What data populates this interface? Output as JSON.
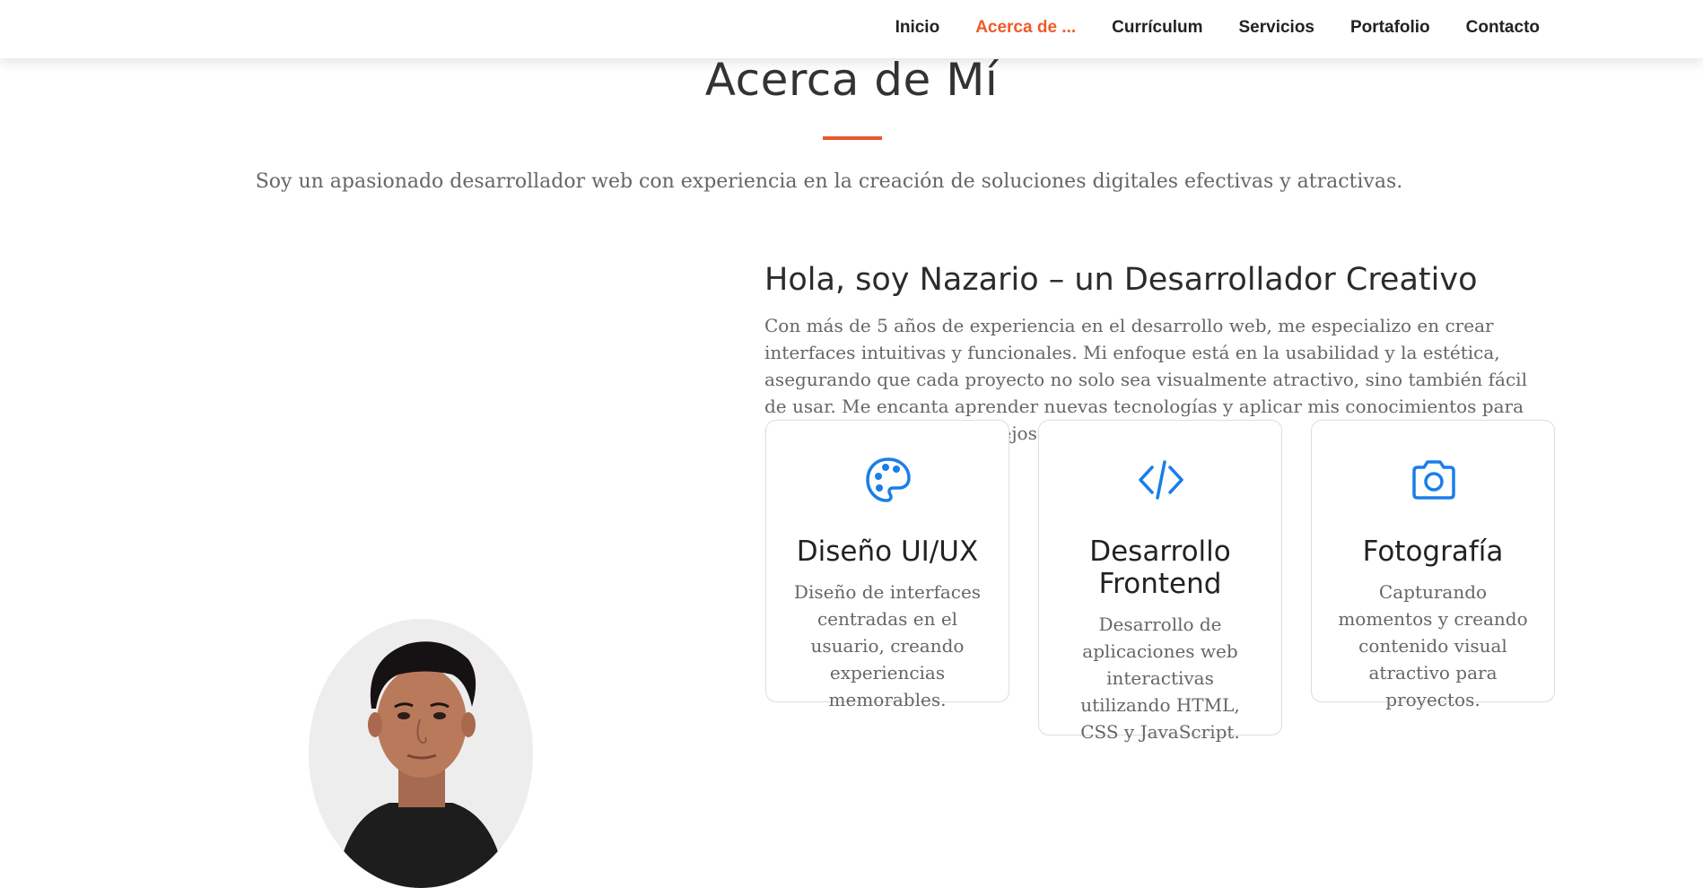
{
  "nav": {
    "items": [
      "Inicio",
      "Acerca de ...",
      "Currículum",
      "Servicios",
      "Portafolio",
      "Contacto"
    ],
    "active_index": 1,
    "active_color": "#f05a28"
  },
  "about": {
    "title": "Acerca de Mí",
    "subtitle": "Soy un apasionado desarrollador web con experiencia en la creación de soluciones digitales efectivas y atractivas.",
    "heading": "Hola, soy Nazario – un Desarrollador Creativo",
    "bio": "Con más de 5 años de experiencia en el desarrollo web, me especializo en crear interfaces intuitivas y funcionales. Mi enfoque está en la usabilidad y la estética, asegurando que cada proyecto no solo sea visualmente atractivo, sino también fácil de usar. Me encanta aprender nuevas tecnologías y aplicar mis conocimientos para resolver problemas complejos."
  },
  "cards": [
    {
      "icon": "palette-icon",
      "title": "Diseño UI/UX",
      "desc": "Diseño de interfaces centradas en el usuario, creando experiencias memorables."
    },
    {
      "icon": "code-icon",
      "title": "Desarrollo Frontend",
      "desc": "Desarrollo de aplicaciones web interactivas utilizando HTML, CSS y JavaScript."
    },
    {
      "icon": "camera-icon",
      "title": "Fotografía",
      "desc": "Capturando momentos y creando contenido visual atractivo para proyectos."
    }
  ],
  "colors": {
    "accent": "#e8582e",
    "icon_blue": "#1a7ee8"
  }
}
